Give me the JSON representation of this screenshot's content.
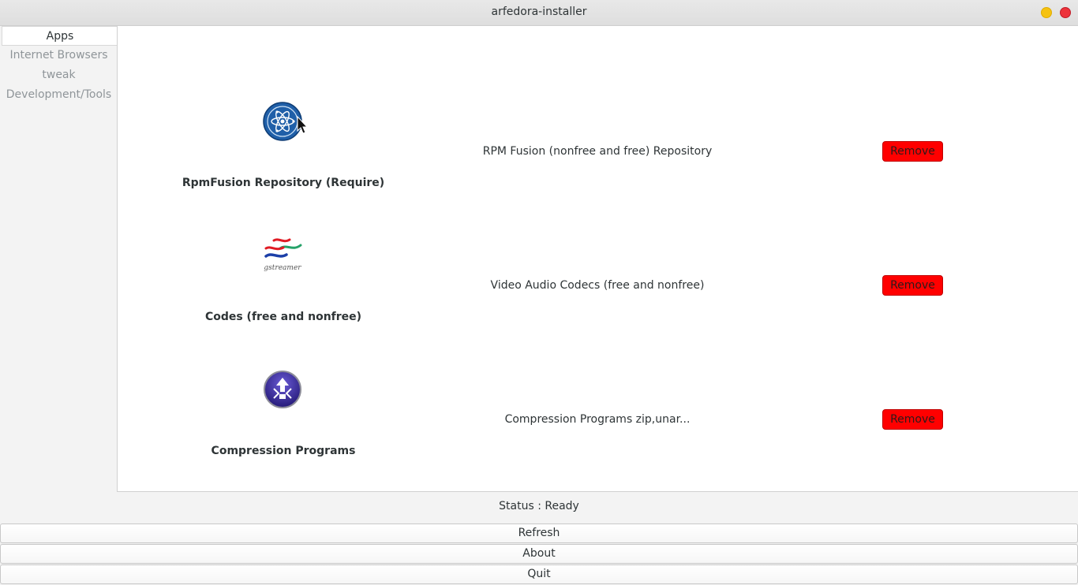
{
  "window": {
    "title": "arfedora-installer"
  },
  "sidebar": {
    "items": [
      {
        "label": "Apps",
        "active": true
      },
      {
        "label": "Internet Browsers",
        "active": false
      },
      {
        "label": "tweak",
        "active": false
      },
      {
        "label": "Development/Tools",
        "active": false
      }
    ]
  },
  "apps": [
    {
      "name": "RpmFusion Repository (Require)",
      "description": "RPM Fusion (nonfree and free) Repository",
      "action": "Remove",
      "icon": "rpmfusion-icon"
    },
    {
      "name": "Codes (free and nonfree)",
      "description": "Video Audio Codecs (free and nonfree)",
      "action": "Remove",
      "icon": "gstreamer-icon",
      "icon_text": "gstreamer"
    },
    {
      "name": "Compression Programs",
      "description": "Compression Programs zip,unar...",
      "action": "Remove",
      "icon": "archive-icon"
    }
  ],
  "status": {
    "text": "Status : Ready"
  },
  "buttons": {
    "refresh": "Refresh",
    "about": "About",
    "quit": "Quit"
  },
  "colors": {
    "remove_button": "#ff0000",
    "minimize": "#f5c211",
    "close": "#ed333b"
  }
}
